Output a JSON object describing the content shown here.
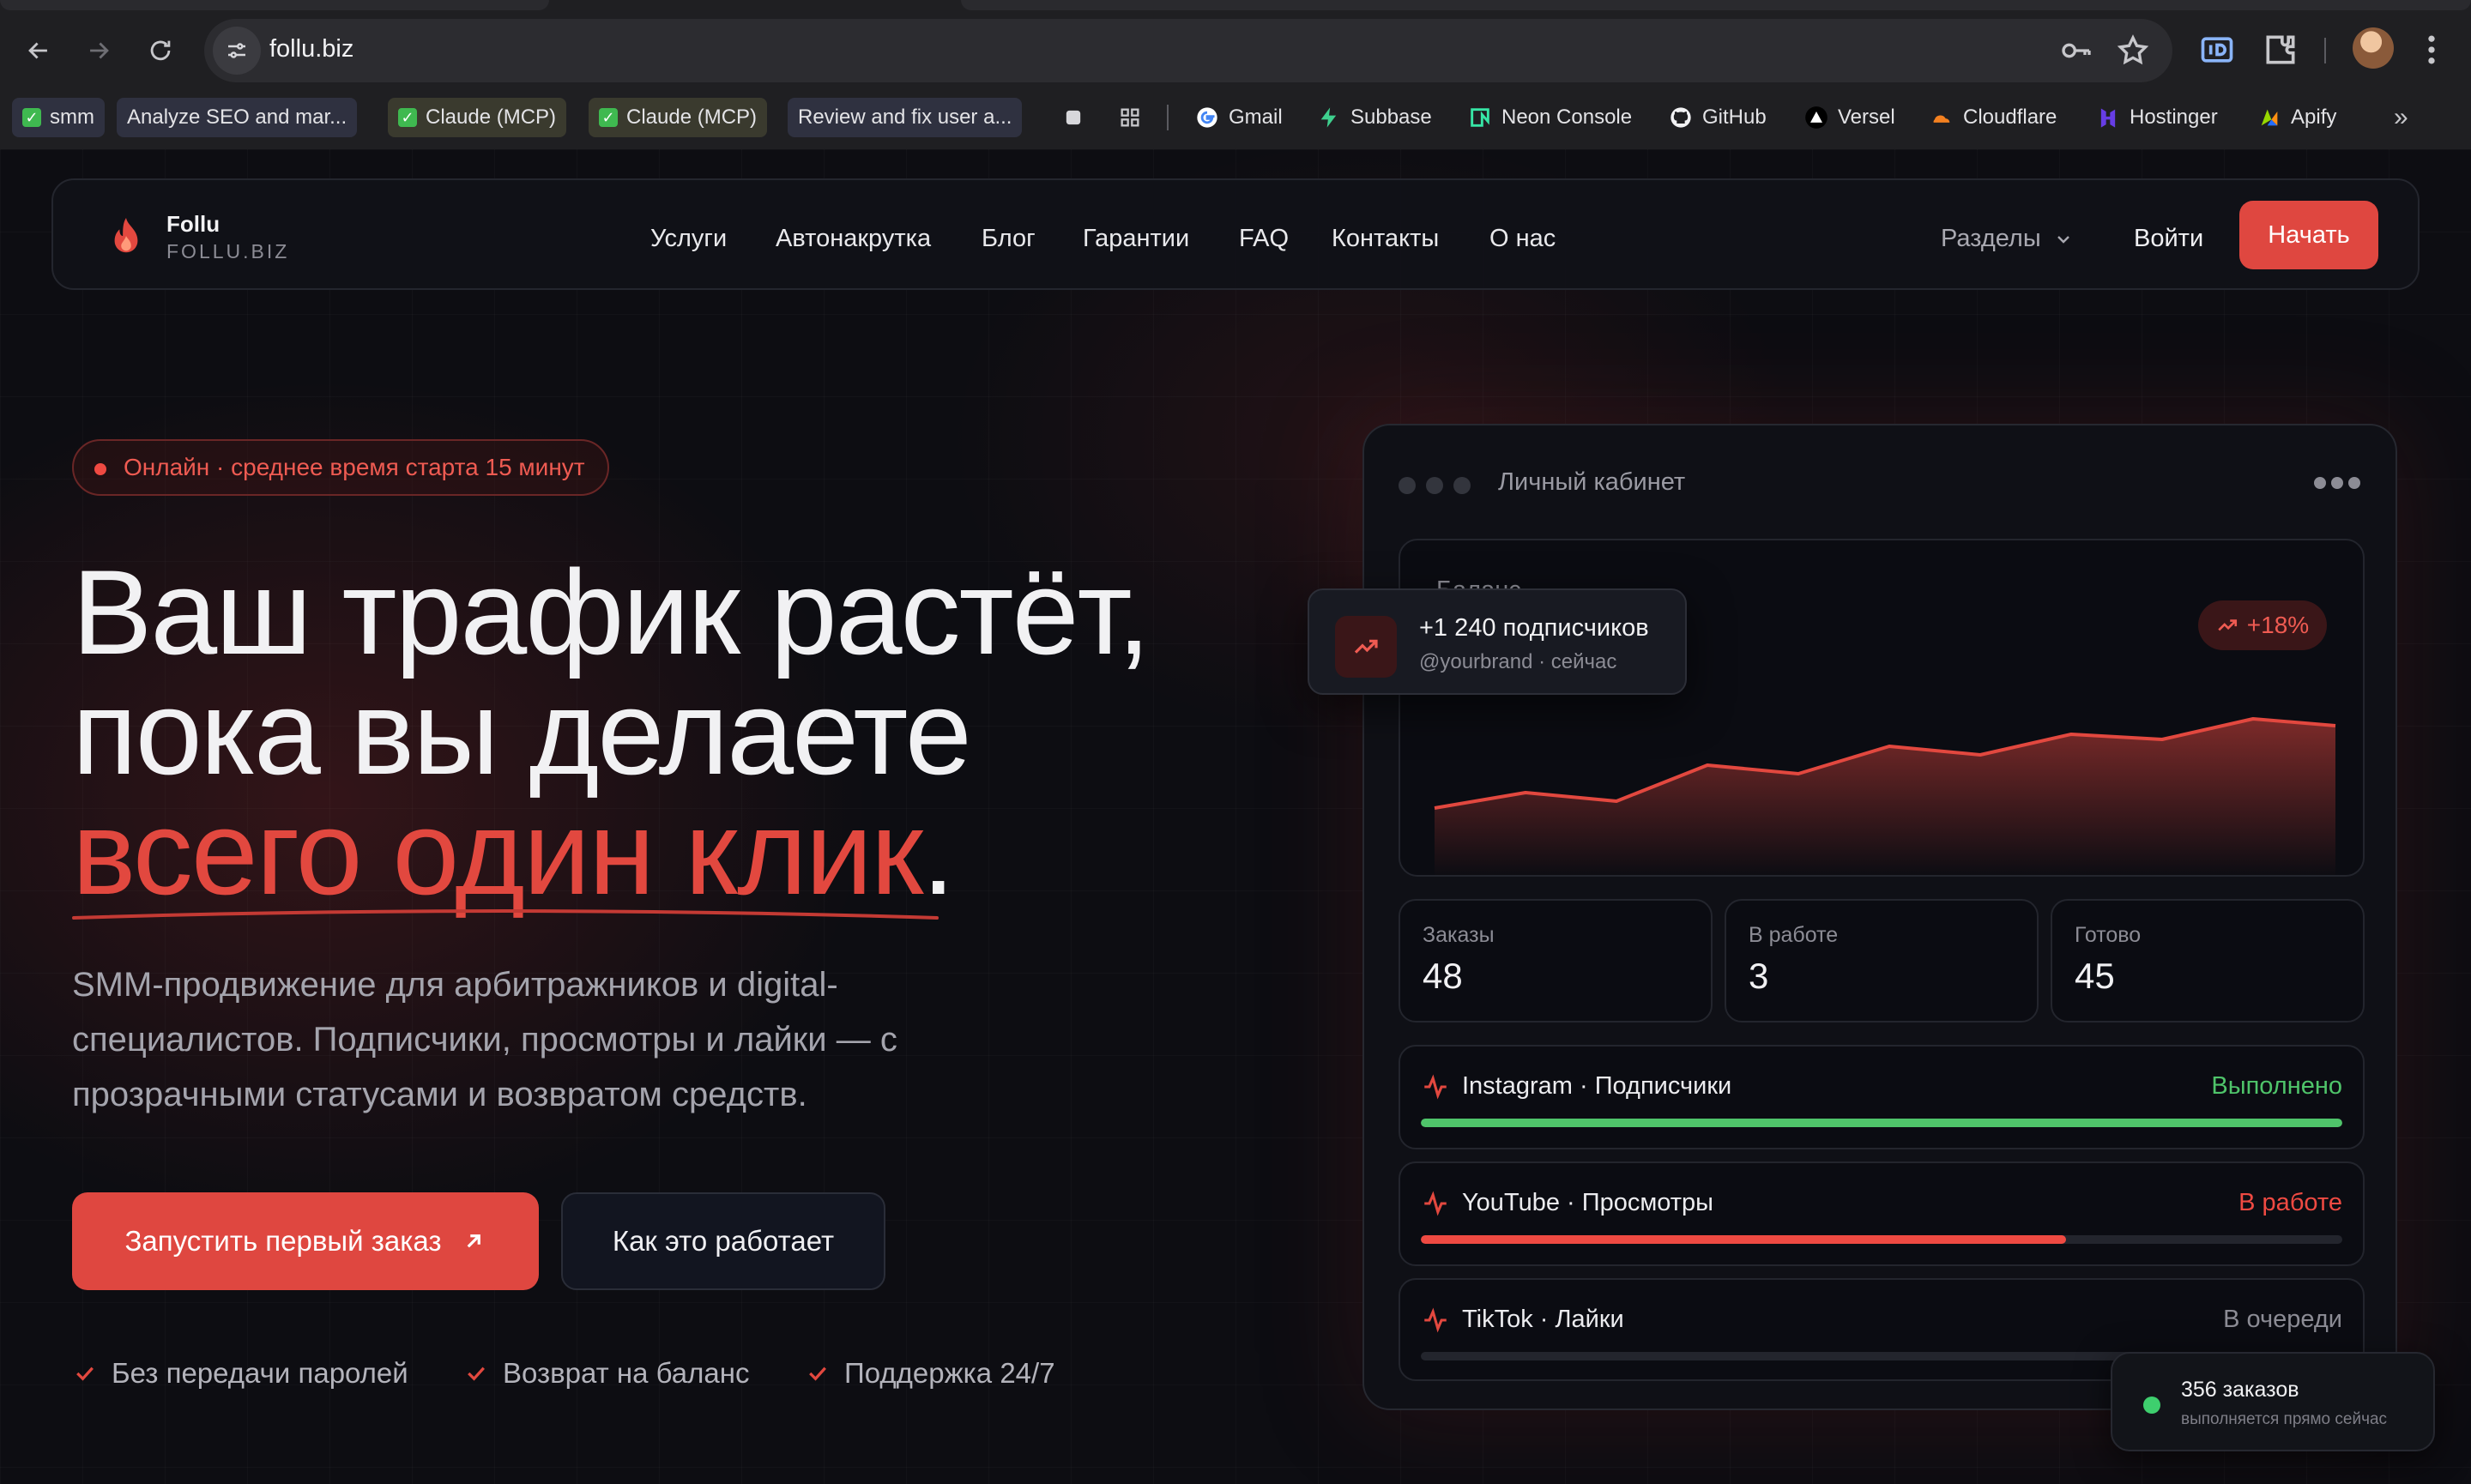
{
  "browser": {
    "url": "follu.biz",
    "bookmarks": [
      {
        "label": "smm",
        "check": true
      },
      {
        "label": "Analyze SEO and mar...",
        "check": false
      },
      {
        "label": "Claude (MCP)",
        "check": true
      },
      {
        "label": "Claude (MCP)",
        "check": true
      },
      {
        "label": "Review and fix user a...",
        "check": false
      },
      {
        "label": "Gmail",
        "icon": "google-icon"
      },
      {
        "label": "Subbase",
        "icon": "bolt-icon"
      },
      {
        "label": "Neon Console",
        "icon": "neon-icon"
      },
      {
        "label": "GitHub",
        "icon": "github-icon"
      },
      {
        "label": "Versel",
        "icon": "triangle-icon"
      },
      {
        "label": "Cloudflare",
        "icon": "cloud-icon"
      },
      {
        "label": "Hostinger",
        "icon": "hostinger-icon"
      },
      {
        "label": "Apify",
        "icon": "apify-icon"
      }
    ]
  },
  "header": {
    "brand_name": "Follu",
    "brand_domain": "FOLLU.BIZ",
    "nav": [
      "Услуги",
      "Автонакрутка",
      "Блог",
      "Гарантии",
      "FAQ",
      "Контакты",
      "О нас"
    ],
    "sections_label": "Разделы",
    "login_label": "Войти",
    "start_label": "Начать"
  },
  "hero": {
    "status": "Онлайн · среднее время старта 15 минут",
    "headline_line1": "Ваш трафик растёт,",
    "headline_line2": "пока вы делаете",
    "headline_accent": "всего один клик",
    "headline_period": ".",
    "lead_line1": "SMM-продвижение для арбитражников и digital-",
    "lead_line2": "специалистов. Подписчики, просмотры и лайки — с",
    "lead_line3": "прозрачными статусами и возвратом средств.",
    "cta_primary": "Запустить первый заказ",
    "cta_secondary": "Как это работает",
    "features": [
      "Без передачи паролей",
      "Возврат на баланс",
      "Поддержка 24/7"
    ]
  },
  "dashboard": {
    "title": "Личный кабинет",
    "balance_label": "Баланс",
    "growth": "+18%",
    "stats": [
      {
        "label": "Заказы",
        "value": "48"
      },
      {
        "label": "В работе",
        "value": "3"
      },
      {
        "label": "Готово",
        "value": "45"
      }
    ],
    "orders": [
      {
        "name": "Instagram · Подписчики",
        "status": "Выполнено",
        "status_color": "#4fc46a",
        "progress": 1.0,
        "fill_color": "#4fc46a"
      },
      {
        "name": "YouTube · Просмотры",
        "status": "В работе",
        "status_color": "#ef4a42",
        "progress": 0.7,
        "fill_color": "#ef4a42"
      },
      {
        "name": "TikTok · Лайки",
        "status": "В очереди",
        "status_color": "#8c8c95",
        "progress": 0.0,
        "fill_color": "#3a3c45"
      }
    ]
  },
  "toast": {
    "title": "+1 240 подписчиков",
    "subtitle": "@yourbrand · сейчас"
  },
  "live": {
    "title": "356 заказов",
    "subtitle": "выполняется прямо сейчас"
  },
  "colors": {
    "accent": "#df4740",
    "success": "#4fc46a",
    "background": "#0d0d12"
  }
}
